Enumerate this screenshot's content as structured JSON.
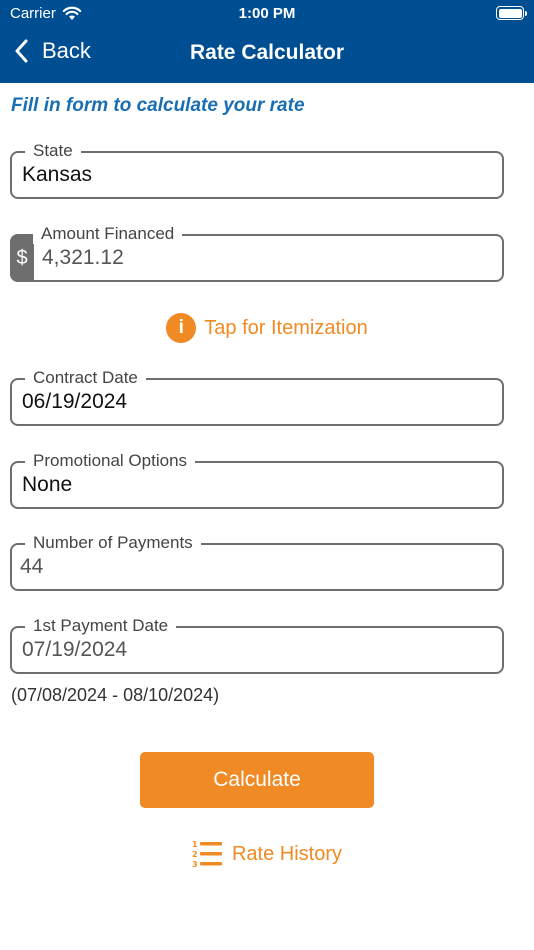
{
  "status_bar": {
    "carrier": "Carrier",
    "time": "1:00 PM"
  },
  "nav": {
    "back_label": "Back",
    "title": "Rate Calculator"
  },
  "instruction": "Fill in form to calculate your rate",
  "fields": {
    "state": {
      "label": "State",
      "value": "Kansas"
    },
    "amount_financed": {
      "label": "Amount Financed",
      "prefix": "$",
      "value": "4,321.12"
    },
    "contract_date": {
      "label": "Contract Date",
      "value": "06/19/2024"
    },
    "promotional_options": {
      "label": "Promotional Options",
      "value": "None"
    },
    "number_of_payments": {
      "label": "Number of Payments",
      "value": "44"
    },
    "first_payment_date": {
      "label": "1st Payment Date",
      "value": "07/19/2024",
      "range": "(07/08/2024 - 08/10/2024)"
    }
  },
  "itemization_link": {
    "icon": "info-icon",
    "label": "Tap for Itemization"
  },
  "calculate_button": {
    "label": "Calculate"
  },
  "rate_history_link": {
    "icon": "numbered-list-icon",
    "label": "Rate History"
  },
  "colors": {
    "nav_bg": "#004e92",
    "accent": "#f08a24",
    "instruction": "#1a6fb3"
  }
}
